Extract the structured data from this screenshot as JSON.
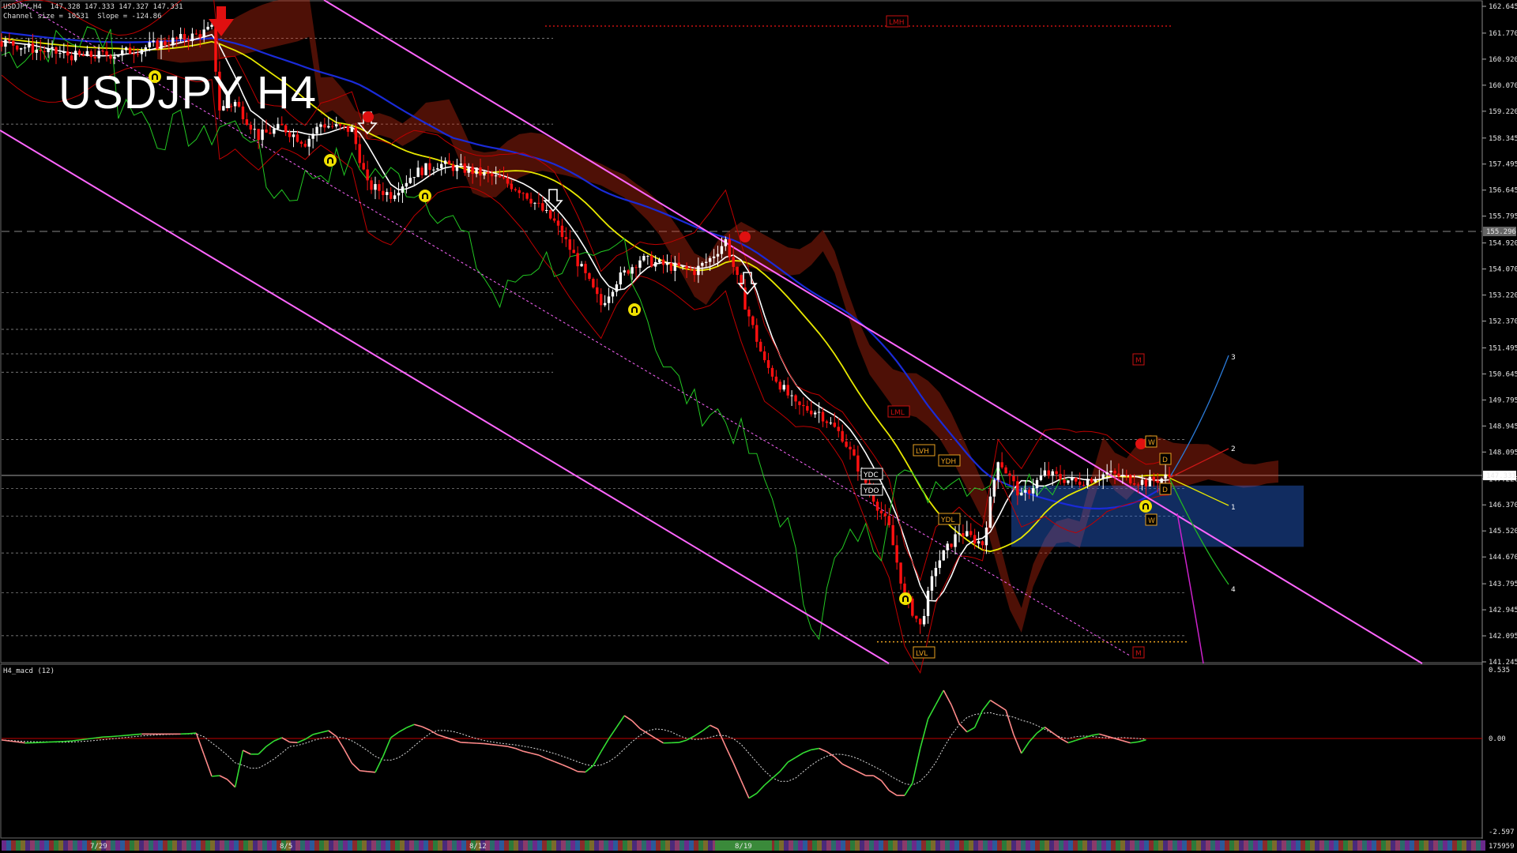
{
  "header": {
    "symbol_line": "USDJPY,H4  147.328 147.333 147.327 147.331",
    "channel_line": "Channel size = 10531  Slope = -124.86",
    "big_title": "USDJPY H4",
    "macd_label": "H4_macd (12)"
  },
  "colors": {
    "background": "#000000",
    "bull_candle": "#ffffff",
    "bear_candle": "#ff1010",
    "channel": "#ff66ff",
    "blue_ma": "#1a2bd8",
    "yellow_ma": "#e8e800",
    "white_ma": "#ffffff",
    "green_line": "#22c822",
    "cloud_bear": "#cc2a10",
    "cloud_bull": "#2a6ef0",
    "grid_dash": "#9a9a9a",
    "macd_pos": "#33dd33",
    "macd_neg": "#ff8a8a",
    "macd_zero": "#c00000"
  },
  "chart_data": {
    "type": "candlestick",
    "symbol": "USDJPY",
    "timeframe": "H4",
    "ylim": [
      141.245,
      162.645
    ],
    "price_ticks": [
      "162.645",
      "161.770",
      "160.920",
      "160.070",
      "159.220",
      "158.345",
      "157.495",
      "156.645",
      "155.795",
      "154.920",
      "154.070",
      "153.220",
      "152.370",
      "151.495",
      "150.645",
      "149.795",
      "148.945",
      "148.095",
      "147.220",
      "146.370",
      "145.520",
      "144.670",
      "143.795",
      "142.945",
      "142.095",
      "141.245"
    ],
    "current_price_label": "147.331",
    "dashed_level_label": "155.296",
    "date_labels": [
      "7/29",
      "8/5",
      "8/12",
      "8/19"
    ],
    "macd": {
      "ticks": [
        "0.535",
        "0.00",
        "-2.597"
      ],
      "bottom_label": "175959"
    },
    "price_path": [
      [
        0,
        161.5
      ],
      [
        10,
        161.2
      ],
      [
        20,
        161.0
      ],
      [
        30,
        161.1
      ],
      [
        40,
        161.4
      ],
      [
        50,
        161.7
      ],
      [
        54,
        161.9
      ],
      [
        56,
        159.3
      ],
      [
        60,
        159.5
      ],
      [
        66,
        158.4
      ],
      [
        72,
        158.7
      ],
      [
        78,
        158.2
      ],
      [
        82,
        158.8
      ],
      [
        90,
        158.6
      ],
      [
        94,
        156.8
      ],
      [
        100,
        156.5
      ],
      [
        106,
        157.2
      ],
      [
        112,
        157.5
      ],
      [
        120,
        157.3
      ],
      [
        128,
        157.0
      ],
      [
        134,
        156.6
      ],
      [
        142,
        155.6
      ],
      [
        148,
        154.3
      ],
      [
        154,
        152.9
      ],
      [
        158,
        153.7
      ],
      [
        164,
        154.4
      ],
      [
        170,
        154.2
      ],
      [
        178,
        154.0
      ],
      [
        182,
        154.4
      ],
      [
        186,
        155.0
      ],
      [
        190,
        153.3
      ],
      [
        196,
        151.0
      ],
      [
        204,
        149.6
      ],
      [
        210,
        149.4
      ],
      [
        216,
        148.6
      ],
      [
        222,
        147.1
      ],
      [
        228,
        145.6
      ],
      [
        232,
        143.4
      ],
      [
        236,
        142.4
      ],
      [
        240,
        144.4
      ],
      [
        246,
        145.5
      ],
      [
        252,
        145.1
      ],
      [
        256,
        147.9
      ],
      [
        262,
        146.6
      ],
      [
        268,
        147.4
      ],
      [
        276,
        147.1
      ],
      [
        284,
        147.4
      ],
      [
        294,
        147.1
      ],
      [
        300,
        147.3
      ]
    ],
    "annotations": {
      "level_boxes": [
        "LMH",
        "LVH",
        "LML",
        "LVL",
        "YDH",
        "YDL",
        "YDC",
        "YDO",
        "M",
        "M",
        "W",
        "W",
        "D",
        "D"
      ],
      "projection_numbers": [
        "3",
        "2",
        "1",
        "4"
      ]
    }
  }
}
